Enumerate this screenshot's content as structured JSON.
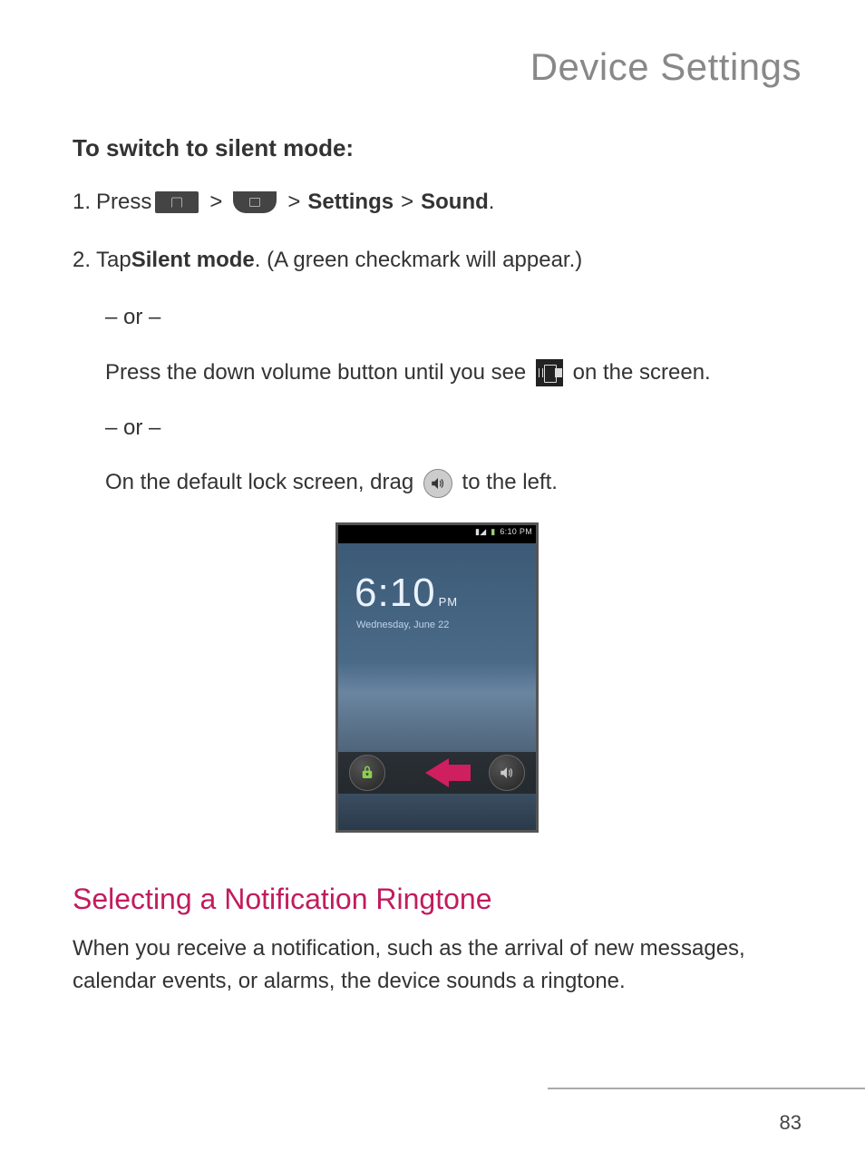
{
  "page_title": "Device Settings",
  "subheading": "To switch to silent mode:",
  "step1": {
    "num": "1.",
    "press": "Press",
    "gt1": ">",
    "gt2": ">",
    "settings": "Settings",
    "gt3": ">",
    "sound": "Sound",
    "period": "."
  },
  "step2": {
    "num": "2.",
    "tap": "Tap ",
    "silent": "Silent mode",
    "after": ". (A green checkmark will appear.)"
  },
  "or": "– or –",
  "alt1_a": "Press the down volume button until you see ",
  "alt1_b": " on the screen.",
  "alt2_a": "On the default lock screen, drag ",
  "alt2_b": " to the left.",
  "lockscreen": {
    "status_time": "6:10 PM",
    "clock": "6:10",
    "ampm": "PM",
    "date": "Wednesday, June 22"
  },
  "section_title": "Selecting a Notification Ringtone",
  "body": "When you receive a notification, such as the arrival of new messages, calendar events, or alarms, the device sounds a ringtone.",
  "page_number": "83"
}
